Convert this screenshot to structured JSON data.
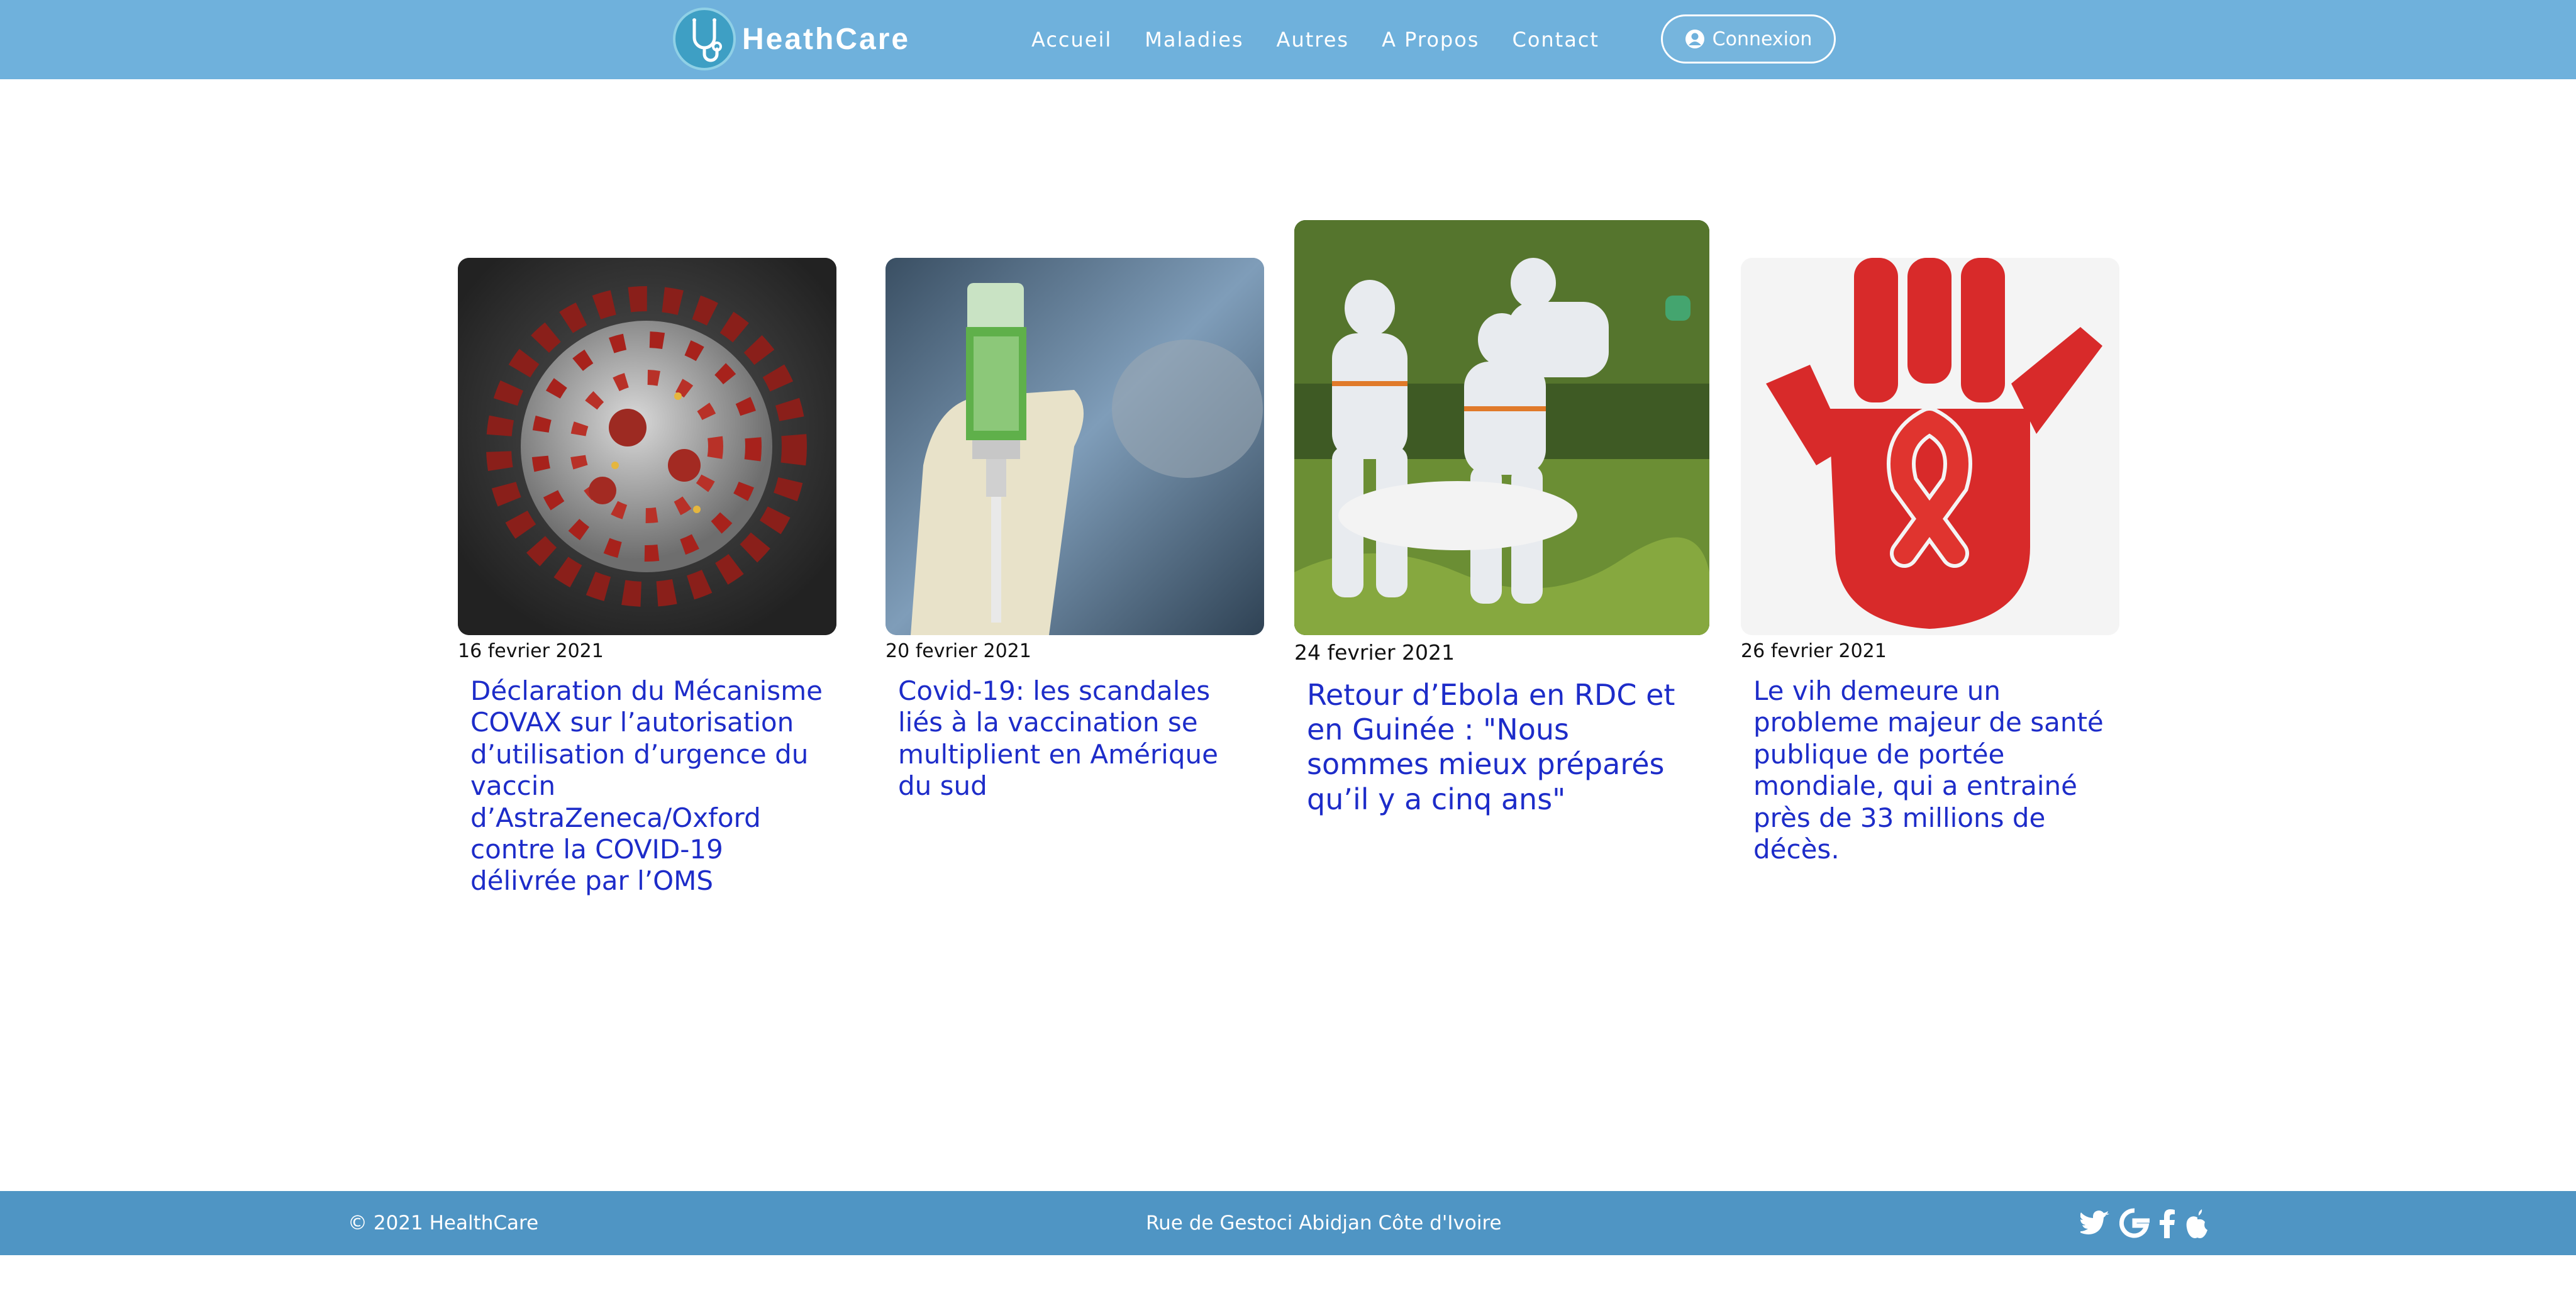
{
  "header": {
    "brand": "HeathCare",
    "nav": [
      "Accueil",
      "Maladies",
      "Autres",
      "A Propos",
      "Contact"
    ],
    "login_label": "Connexion",
    "icons": {
      "logo": "stethoscope-icon",
      "login": "user-circle-icon"
    }
  },
  "articles": [
    {
      "date": "16 fevrier 2021",
      "title": "Déclaration du Mécanisme COVAX sur l’autorisation d’utilisation d’urgence du vaccin d’AstraZeneca/Oxford contre la COVID-19 délivrée par l’OMS",
      "image": "coronavirus-image"
    },
    {
      "date": "20 fevrier 2021",
      "title": "Covid-19: les scandales liés à la vaccination se multiplient en Amérique du sud",
      "image": "vaccine-vial-image"
    },
    {
      "date": "24 fevrier 2021",
      "title": "Retour d’Ebola en RDC et en Guinée : \"Nous sommes mieux préparés qu’il y a cinq ans\"",
      "image": "ebola-workers-image"
    },
    {
      "date": "26 fevrier 2021",
      "title": "Le vih demeure un probleme majeur de santé publique de portée mondiale, qui a entrainé près de 33 millions de décès.",
      "image": "aids-ribbon-hand-image"
    }
  ],
  "footer": {
    "copyright": "© 2021 HealthCare",
    "address": "Rue de Gestoci Abidjan Côte d'Ivoire",
    "social_icons": [
      "twitter-icon",
      "google-icon",
      "facebook-icon",
      "apple-icon"
    ]
  },
  "colors": {
    "navbar": "#6fb1dc",
    "footer": "#4f95c4",
    "link": "#1d2cc9"
  }
}
